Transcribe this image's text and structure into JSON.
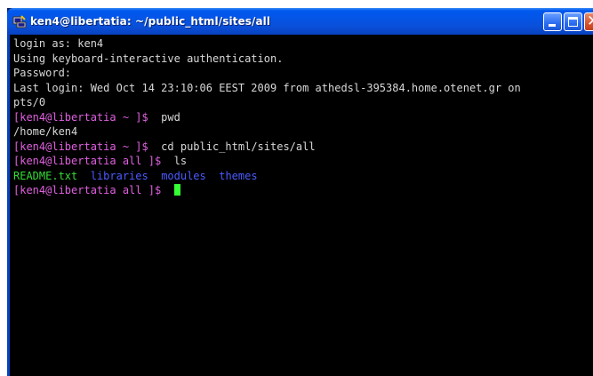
{
  "window": {
    "title": "ken4@libertatia: ~/public_html/sites/all",
    "icon": "putty-icon",
    "buttons": {
      "minimize": "minimize-icon",
      "maximize": "maximize-icon",
      "close": "close-icon"
    }
  },
  "terminal": {
    "lines": [
      "login as: ken4",
      "Using keyboard-interactive authentication.",
      "Password:",
      "Last login: Wed Oct 14 23:10:06 EEST 2009 from athedsl-395384.home.otenet.gr on",
      "pts/0"
    ],
    "prompt_home": "[ken4@libertatia ~ ]$",
    "cmd_pwd": "pwd",
    "pwd_output": "/home/ken4",
    "cmd_cd": "cd public_html/sites/all",
    "prompt_all": "[ken4@libertatia all ]$",
    "cmd_ls": "ls",
    "ls_output": {
      "readme": "README.txt",
      "libraries": "libraries",
      "modules": "modules",
      "themes": "themes"
    }
  },
  "colors": {
    "prompt": "#e060e0",
    "file": "#33dd33",
    "directory": "#4b5bff",
    "cursor": "#33ff33",
    "titlebar": "#0555e6"
  }
}
